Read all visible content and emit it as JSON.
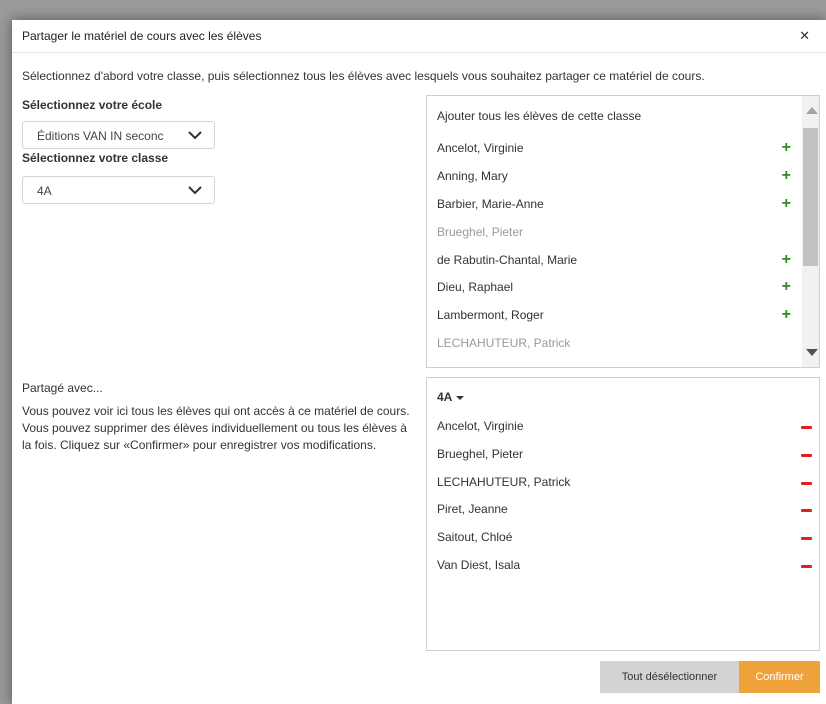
{
  "dialog": {
    "title": "Partager le matériel de cours avec les élèves",
    "close_icon": "close-icon",
    "intro": "Sélectionnez d'abord votre classe, puis sélectionnez tous les élèves avec lesquels vous souhaitez partager ce matériel de cours."
  },
  "school": {
    "label": "Sélectionnez votre école",
    "value": "Éditions VAN IN seconc"
  },
  "class_select": {
    "label": "Sélectionnez votre classe",
    "value": "4A"
  },
  "available": {
    "add_all": "Ajouter tous les élèves de cette classe",
    "students": [
      {
        "name": "Ancelot, Virginie",
        "addable": true
      },
      {
        "name": "Anning, Mary",
        "addable": true
      },
      {
        "name": "Barbier, Marie-Anne",
        "addable": true
      },
      {
        "name": "Brueghel, Pieter",
        "addable": false
      },
      {
        "name": "de Rabutin-Chantal, Marie",
        "addable": true
      },
      {
        "name": "Dieu, Raphael",
        "addable": true
      },
      {
        "name": "Lambermont, Roger",
        "addable": true
      },
      {
        "name": "LECHAHUTEUR, Patrick",
        "addable": false
      }
    ],
    "add_icon": "plus-icon"
  },
  "shared": {
    "title": "Partagé avec...",
    "description": "Vous pouvez voir ici tous les élèves qui ont accès à ce matériel de cours. Vous pouvez supprimer des élèves individuellement ou tous les élèves à la fois. Cliquez sur «Confirmer» pour enregistrer vos modifications.",
    "class_label": "4A",
    "students": [
      "Ancelot, Virginie",
      "Brueghel, Pieter",
      "LECHAHUTEUR, Patrick",
      "Piret, Jeanne",
      "Saitout, Chloé",
      "Van Diest, Isala"
    ],
    "remove_icon": "minus-icon"
  },
  "buttons": {
    "deselect_all": "Tout désélectionner",
    "confirm": "Confirmer"
  },
  "colors": {
    "add": "#2e8b1f",
    "remove": "#e0201c",
    "confirm": "#f0a23a",
    "deselect": "#d3d3d3"
  }
}
